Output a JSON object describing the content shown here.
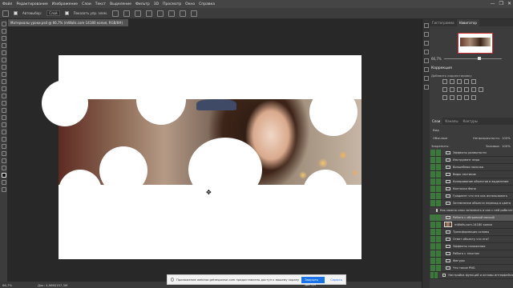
{
  "menu": [
    "Файл",
    "Редактирование",
    "Изображение",
    "Слои",
    "Текст",
    "Выделение",
    "Фильтр",
    "3D",
    "Просмотр",
    "Окно",
    "Справка"
  ],
  "window_controls": [
    "—",
    "❐",
    "✕"
  ],
  "options": {
    "autoselect_label": "Автовыбор:",
    "autoselect_value": "Слой",
    "show_transform_label": "Показать упр. элем."
  },
  "document": {
    "tab_title": "Материалы уроки.psd @ 66,7% (mWalls.com-14180 копия, RGB/8#)",
    "zoom": "66,7%",
    "doc_info": "Док: 4,96M/157,3M"
  },
  "notice": {
    "text": "Приложение webinar.getresponse.com предоставлено доступ к вашему экрану",
    "allow": "Закрыть доступ",
    "hide": "Скрыть"
  },
  "navigator": {
    "tabs": [
      "Гистограмма",
      "Навигатор"
    ],
    "zoom": "66,7%"
  },
  "adjustments": {
    "title": "Коррекция",
    "subtitle": "Добавить корректировку"
  },
  "layers": {
    "tabs": [
      "Слои",
      "Каналы",
      "Контуры"
    ],
    "kind": "Вид",
    "blend": "Обычные",
    "opacity_label": "Непрозрачность:",
    "opacity": "100%",
    "lock_label": "Закрепить:",
    "fill_label": "Заливка:",
    "fill": "100%",
    "rows": [
      "Эффекты размытости",
      "Инструмент перо",
      "Волшебная палочка",
      "Виды ластиков",
      "Копирование объектов в выделение",
      "Кисточки Фона",
      "Градиент что это как использовать",
      "Затемнение объекта переход в цвета",
      "Как можно слои затемнить и как с ней работать",
      "Работа с обтравкой маской",
      "mWalls.com-14180 копия",
      "Трансформация основы",
      "Ответ объекту что это?",
      "Эффекты наложения",
      "Работа с текстом",
      "Фигуры",
      "Что такое PNG",
      "Настройка функций и основы интерфейса"
    ]
  }
}
